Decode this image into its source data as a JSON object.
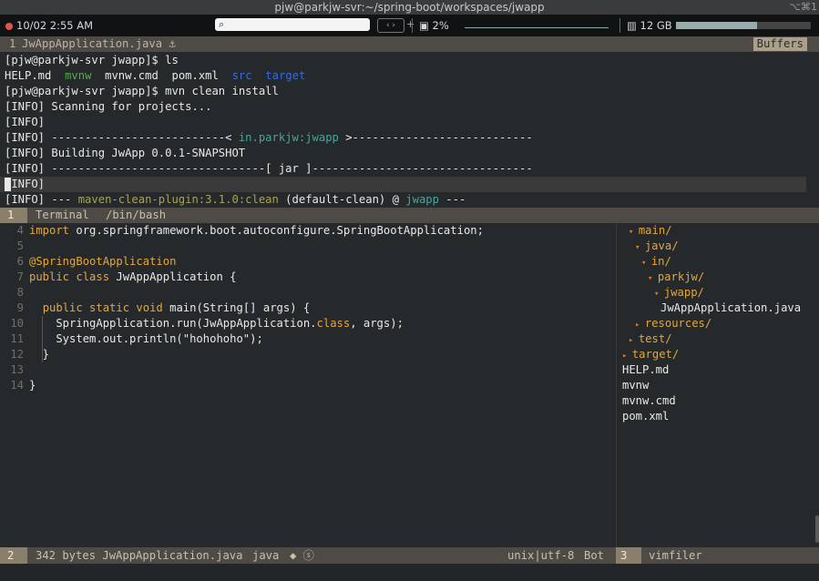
{
  "window": {
    "title": "pjw@parkjw-svr:~/spring-boot/workspaces/jwapp",
    "shortcut": "⌥⌘1"
  },
  "statusbar": {
    "datetime": "10/02 2:55 AM",
    "cpu": "2%",
    "memory": "12 GB",
    "search_icon": "search-icon",
    "colors": {
      "record_dot": "#e2534a"
    }
  },
  "top_tab": {
    "number": "1",
    "filename": "JwAppApplication.java",
    "buffers_label": "Buffers"
  },
  "terminal": {
    "lines": [
      {
        "prompt": "[pjw@parkjw-svr jwapp]$",
        "cmd": "ls"
      },
      {
        "ls": [
          "HELP.md",
          "mvnw",
          "mvnw.cmd",
          "pom.xml",
          "src",
          "target"
        ]
      },
      {
        "prompt": "[pjw@parkjw-svr jwapp]$",
        "cmd": "mvn clean install"
      },
      {
        "text": "[INFO] Scanning for projects..."
      },
      {
        "text": "[INFO]"
      },
      {
        "pre": "[INFO] --------------------------< ",
        "hl": "in.parkjw:jwapp",
        "post": " >---------------------------"
      },
      {
        "text": "[INFO] Building JwApp 0.0.1-SNAPSHOT"
      },
      {
        "text": "[INFO] --------------------------------[ jar ]---------------------------------"
      },
      {
        "text": "[INFO]"
      },
      {
        "pre": "[INFO] --- ",
        "hl": "maven-clean-plugin:3.1.0:clean",
        "mid": " (default-clean) @ ",
        "hl2": "jwapp",
        "post": " ---"
      }
    ]
  },
  "term_bar": {
    "number": "1",
    "label": "Terminal",
    "shell": "/bin/bash"
  },
  "code": {
    "lines": [
      {
        "n": "4",
        "parts": [
          [
            "kw",
            "import"
          ],
          [
            "t",
            " org.springframework.boot.autoconfigure.SpringBootApplication;"
          ]
        ]
      },
      {
        "n": "5",
        "parts": []
      },
      {
        "n": "6",
        "parts": [
          [
            "ann",
            "@SpringBootApplication"
          ]
        ]
      },
      {
        "n": "7",
        "parts": [
          [
            "kw",
            "public class"
          ],
          [
            "t",
            " JwAppApplication {"
          ]
        ]
      },
      {
        "n": "8",
        "parts": []
      },
      {
        "n": "9",
        "parts": [
          [
            "t",
            "  "
          ],
          [
            "kw",
            "public static void"
          ],
          [
            "t",
            " main(String"
          ],
          [
            "t",
            "[]"
          ],
          [
            "t",
            " args) {"
          ]
        ]
      },
      {
        "n": "10",
        "parts": [
          [
            "t",
            "    SpringApplication.run(JwAppApplication."
          ],
          [
            "kw",
            "class"
          ],
          [
            "t",
            ", args);"
          ]
        ]
      },
      {
        "n": "11",
        "parts": [
          [
            "t",
            "    System.out.println(\"hohohoho\");"
          ]
        ]
      },
      {
        "n": "12",
        "parts": [
          [
            "t",
            "  }"
          ]
        ]
      },
      {
        "n": "13",
        "parts": []
      },
      {
        "n": "14",
        "parts": [
          [
            "t",
            "}"
          ]
        ]
      }
    ]
  },
  "filer": {
    "items": [
      {
        "label": "main/",
        "type": "dir",
        "open": true,
        "depth": 1
      },
      {
        "label": "java/",
        "type": "dir",
        "open": true,
        "depth": 2
      },
      {
        "label": "in/",
        "type": "dir",
        "open": true,
        "depth": 3
      },
      {
        "label": "parkjw/",
        "type": "dir",
        "open": true,
        "depth": 4
      },
      {
        "label": "jwapp/",
        "type": "dir",
        "open": true,
        "depth": 5
      },
      {
        "label": "JwAppApplication.java",
        "type": "file",
        "depth": 6
      },
      {
        "label": "resources/",
        "type": "dir",
        "open": false,
        "depth": 2
      },
      {
        "label": "test/",
        "type": "dir",
        "open": false,
        "depth": 1
      },
      {
        "label": "target/",
        "type": "dir",
        "open": false,
        "depth": 0
      },
      {
        "label": "HELP.md",
        "type": "file",
        "depth": 0
      },
      {
        "label": "mvnw",
        "type": "file",
        "depth": 0
      },
      {
        "label": "mvnw.cmd",
        "type": "file",
        "depth": 0
      },
      {
        "label": "pom.xml",
        "type": "file",
        "depth": 0
      }
    ]
  },
  "status_left": {
    "number": "2",
    "info": "342 bytes JwAppApplication.java",
    "filetype": "java",
    "marks": "◆ ⓢ",
    "encoding": "unix|utf-8",
    "position": "Bot"
  },
  "status_right": {
    "number": "3",
    "label": "vimfiler"
  }
}
